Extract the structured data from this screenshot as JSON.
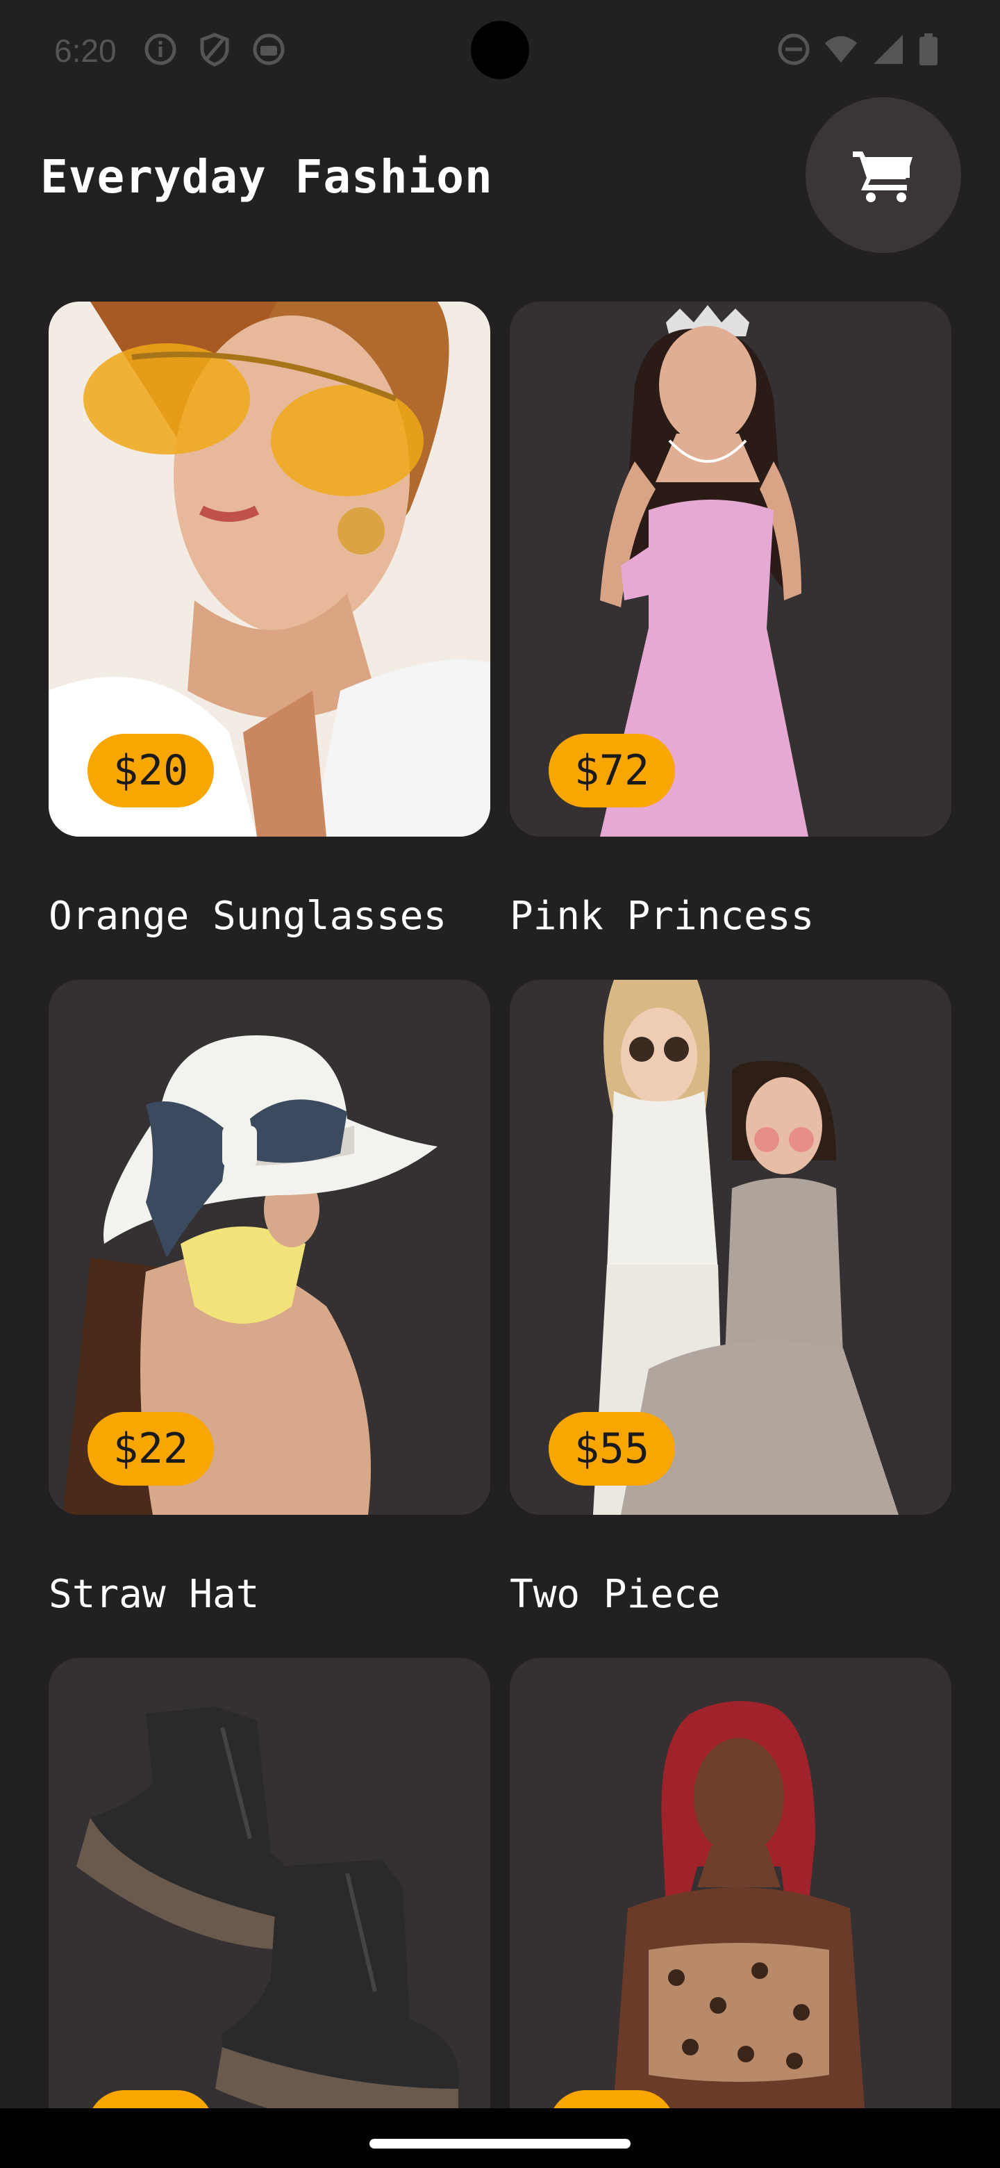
{
  "status_bar": {
    "time": "6:20",
    "icons_left": [
      "info-icon",
      "shield-icon",
      "android-icon"
    ],
    "icons_right": [
      "dnd-icon",
      "wifi-icon",
      "signal-icon",
      "battery-icon"
    ]
  },
  "header": {
    "title": "Everyday Fashion",
    "cart_icon": "cart-icon"
  },
  "colors": {
    "background": "#222021",
    "card": "#353132",
    "badge": "#f9a700",
    "cart_button": "#3a3637"
  },
  "products": [
    {
      "name": "Orange Sunglasses",
      "price": "$20"
    },
    {
      "name": "Pink Princess",
      "price": "$72"
    },
    {
      "name": "Straw Hat",
      "price": "$22"
    },
    {
      "name": "Two Piece",
      "price": "$55"
    },
    {
      "name": "",
      "price": ""
    },
    {
      "name": "",
      "price": ""
    }
  ]
}
